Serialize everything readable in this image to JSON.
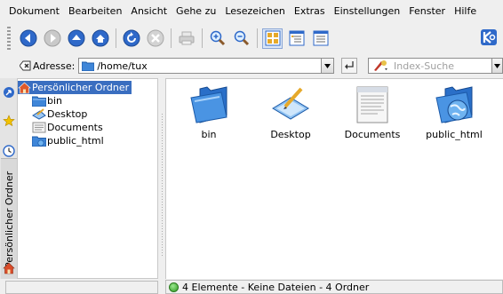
{
  "menubar": {
    "items": [
      {
        "label": "Dokument"
      },
      {
        "label": "Bearbeiten"
      },
      {
        "label": "Ansicht"
      },
      {
        "label": "Gehe zu"
      },
      {
        "label": "Lesezeichen"
      },
      {
        "label": "Extras"
      },
      {
        "label": "Einstellungen"
      },
      {
        "label": "Fenster"
      },
      {
        "label": "Hilfe"
      }
    ]
  },
  "toolbar": {
    "buttons": [
      "back-icon",
      "forward-icon",
      "up-icon",
      "home-icon",
      "reload-icon",
      "stop-icon",
      "print-icon",
      "zoom-in-icon",
      "zoom-out-icon",
      "icon-view-icon",
      "tree-view-icon",
      "list-view-icon"
    ]
  },
  "address": {
    "label": "Adresse:",
    "value": "/home/tux",
    "search_placeholder": "Index-Suche"
  },
  "tree": {
    "items": [
      {
        "label": "Persönlicher Ordner",
        "selected": true
      },
      {
        "label": "bin"
      },
      {
        "label": "Desktop"
      },
      {
        "label": "Documents"
      },
      {
        "label": "public_html"
      }
    ]
  },
  "sidebar": {
    "vertical_tab_label": "Persönlicher Ordner"
  },
  "main": {
    "files": [
      {
        "label": "bin"
      },
      {
        "label": "Desktop"
      },
      {
        "label": "Documents"
      },
      {
        "label": "public_html"
      }
    ]
  },
  "status": {
    "text": "4 Elemente - Keine Dateien - 4 Ordner"
  },
  "colors": {
    "selection": "#3a6ec0",
    "folder_blue": "#3f86d8",
    "nav_blue": "#2f69c9"
  }
}
